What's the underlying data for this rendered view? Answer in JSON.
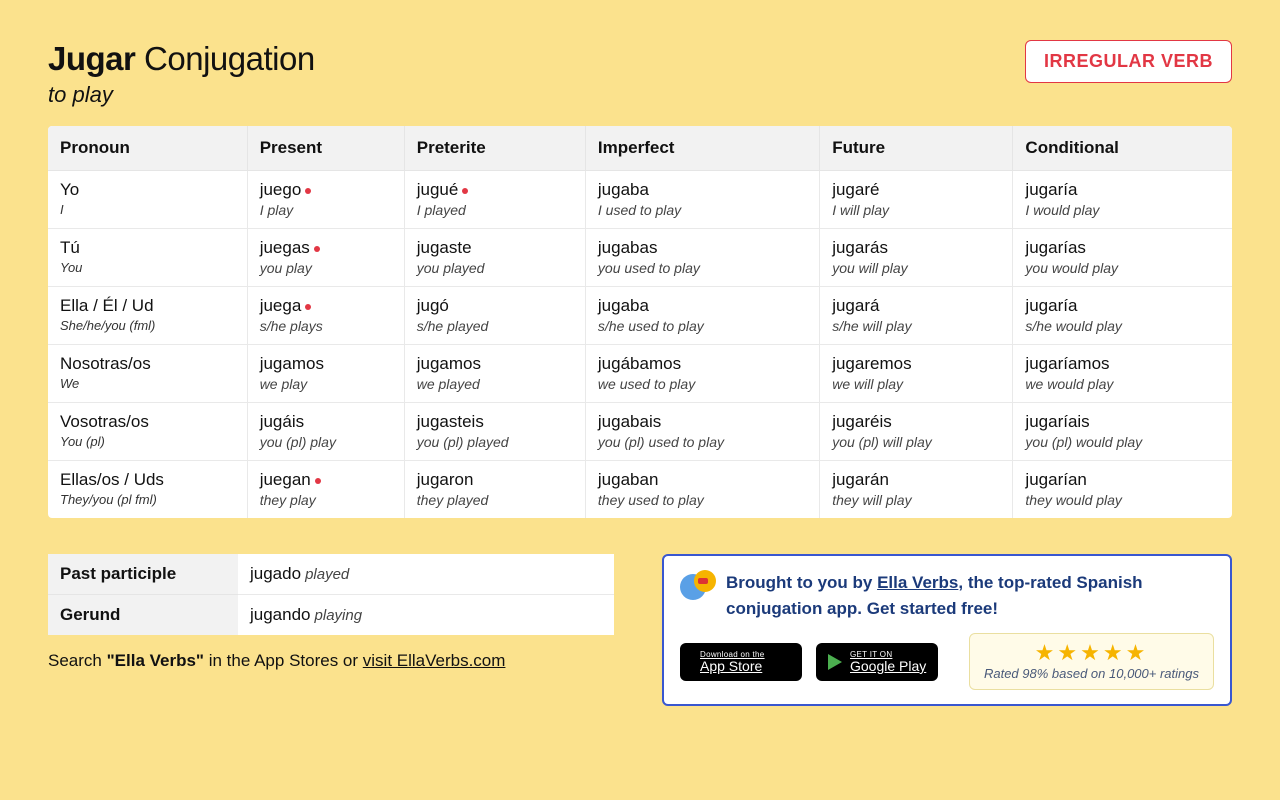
{
  "header": {
    "verb": "Jugar",
    "heading_rest": "Conjugation",
    "translation": "to play",
    "badge": "IRREGULAR VERB"
  },
  "columns": [
    "Pronoun",
    "Present",
    "Preterite",
    "Imperfect",
    "Future",
    "Conditional"
  ],
  "rows": [
    {
      "pron": "Yo",
      "pron_sub": "I",
      "present": {
        "v": "juego",
        "g": "I play",
        "irr": true
      },
      "preterite": {
        "v": "jugué",
        "g": "I played",
        "irr": true
      },
      "imperfect": {
        "v": "jugaba",
        "g": "I used to play"
      },
      "future": {
        "v": "jugaré",
        "g": "I will play"
      },
      "conditional": {
        "v": "jugaría",
        "g": "I would play"
      }
    },
    {
      "pron": "Tú",
      "pron_sub": "You",
      "present": {
        "v": "juegas",
        "g": "you play",
        "irr": true
      },
      "preterite": {
        "v": "jugaste",
        "g": "you played"
      },
      "imperfect": {
        "v": "jugabas",
        "g": "you used to play"
      },
      "future": {
        "v": "jugarás",
        "g": "you will play"
      },
      "conditional": {
        "v": "jugarías",
        "g": "you would play"
      }
    },
    {
      "pron": "Ella / Él / Ud",
      "pron_sub": "She/he/you (fml)",
      "present": {
        "v": "juega",
        "g": "s/he plays",
        "irr": true
      },
      "preterite": {
        "v": "jugó",
        "g": "s/he played"
      },
      "imperfect": {
        "v": "jugaba",
        "g": "s/he used to play"
      },
      "future": {
        "v": "jugará",
        "g": "s/he will play"
      },
      "conditional": {
        "v": "jugaría",
        "g": "s/he would play"
      }
    },
    {
      "pron": "Nosotras/os",
      "pron_sub": "We",
      "present": {
        "v": "jugamos",
        "g": "we play"
      },
      "preterite": {
        "v": "jugamos",
        "g": "we played"
      },
      "imperfect": {
        "v": "jugábamos",
        "g": "we used to play"
      },
      "future": {
        "v": "jugaremos",
        "g": "we will play"
      },
      "conditional": {
        "v": "jugaríamos",
        "g": "we would play"
      }
    },
    {
      "pron": "Vosotras/os",
      "pron_sub": "You (pl)",
      "present": {
        "v": "jugáis",
        "g": "you (pl) play"
      },
      "preterite": {
        "v": "jugasteis",
        "g": "you (pl) played"
      },
      "imperfect": {
        "v": "jugabais",
        "g": "you (pl) used to play"
      },
      "future": {
        "v": "jugaréis",
        "g": "you (pl) will play"
      },
      "conditional": {
        "v": "jugaríais",
        "g": "you (pl) would play"
      }
    },
    {
      "pron": "Ellas/os / Uds",
      "pron_sub": "They/you (pl fml)",
      "present": {
        "v": "juegan",
        "g": "they play",
        "irr": true
      },
      "preterite": {
        "v": "jugaron",
        "g": "they played"
      },
      "imperfect": {
        "v": "jugaban",
        "g": "they used to play"
      },
      "future": {
        "v": "jugarán",
        "g": "they will play"
      },
      "conditional": {
        "v": "jugarían",
        "g": "they would play"
      }
    }
  ],
  "forms": {
    "past_participle_label": "Past participle",
    "past_participle": "jugado",
    "past_participle_gloss": "played",
    "gerund_label": "Gerund",
    "gerund": "jugando",
    "gerund_gloss": "playing"
  },
  "search_text": {
    "prefix": "Search ",
    "quoted": "\"Ella Verbs\"",
    "mid": " in the App Stores or ",
    "link": "visit EllaVerbs.com"
  },
  "promo": {
    "text_prefix": "Brought to you by ",
    "link": "Ella Verbs",
    "text_suffix": ", the top-rated Spanish conjugation app. Get started free!",
    "appstore_small": "Download on the",
    "appstore_big": "App Store",
    "play_small": "GET IT ON",
    "play_big": "Google Play",
    "rating_text": "Rated 98% based on 10,000+ ratings"
  }
}
